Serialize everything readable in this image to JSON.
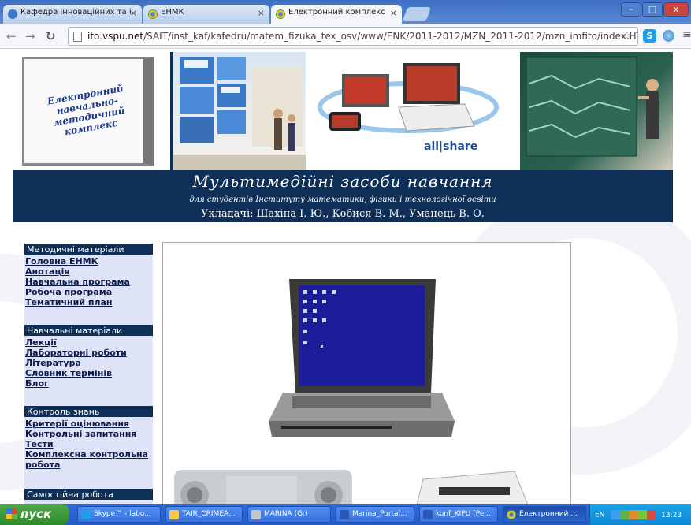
{
  "browser": {
    "tabs": [
      {
        "title": "Кафедра інноваційних та і",
        "active": false
      },
      {
        "title": "ЕНМК",
        "active": false
      },
      {
        "title": "Електронний комплекс",
        "active": true
      }
    ],
    "close_glyph": "×",
    "url_prefix": "ito.vspu.net",
    "url_rest": "/SAIT/inst_kaf/kafedru/matem_fizuka_tex_osv/www/ENK/2011-2012/MZN_2011-2012/mzn_imfito/index.HTM",
    "window_buttons": [
      "–",
      "□",
      "x"
    ]
  },
  "banner": {
    "board_text": "Електронний навчально-методичний комплекс",
    "allshare_text": "all|share",
    "title": "Мультимедійні засоби навчання",
    "subtitle": "для студентів Інституту математики, фізики і технологічної освіти",
    "authors": "Укладачі: Шахіна І. Ю., Кобися В. М., Уманець В. О."
  },
  "sidebar": {
    "sections": [
      {
        "heading": "Методичні матеріали",
        "links": [
          "Головна ЕНМК",
          "Анотація",
          "Навчальна програма",
          "Робоча програма",
          "Тематичний план"
        ]
      },
      {
        "heading": "Навчальні матеріали",
        "links": [
          "Лекції",
          "Лабораторні роботи",
          "Література",
          "Словник термінів",
          "Блог"
        ]
      },
      {
        "heading": "Контроль знань",
        "links": [
          "Критерії оцінювання",
          "Контрольні запитання",
          "Тести",
          "Комплексна контрольна",
          "робота"
        ]
      },
      {
        "heading": "Самостійна робота",
        "links": []
      }
    ]
  },
  "taskbar": {
    "start_label": "пуск",
    "buttons": [
      "Skype™ - labo...",
      "TAIR_CRIMEA...",
      "MARINA (G:)",
      "Marina_Portal...",
      "konf_KIPU [Pe...",
      "Електронний ..."
    ],
    "tray_lang": "EN",
    "clock": "13:23"
  },
  "colors": {
    "banner_bg": "#0e2f57",
    "sidebar_bg": "#dfe3f7",
    "taskbar": "#245cc8",
    "start": "#2d8a2b"
  }
}
